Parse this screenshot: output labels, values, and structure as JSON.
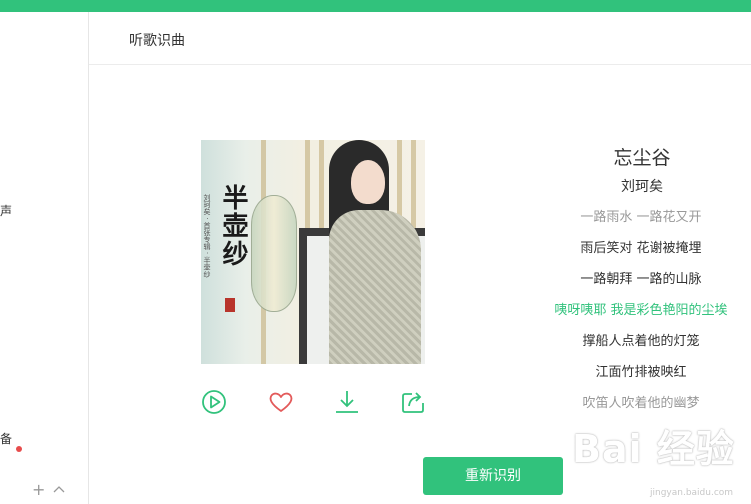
{
  "sidebar": {
    "partial_text_1": "声",
    "partial_text_2": "备",
    "plus_symbol": "+"
  },
  "header": {
    "title": "听歌识曲"
  },
  "cover": {
    "album_title": "半壶纱",
    "subtitle": "刘珂矣 · 首张专辑 · 半壶纱"
  },
  "song": {
    "title": "忘尘谷",
    "artist": "刘珂矣"
  },
  "lyrics": [
    {
      "text": "一路雨水 一路花又开",
      "state": "faded"
    },
    {
      "text": "雨后笑对 花谢被掩埋",
      "state": "normal"
    },
    {
      "text": "一路朝拜 一路的山脉",
      "state": "normal"
    },
    {
      "text": "咦呀咦耶 我是彩色艳阳的尘埃",
      "state": "current"
    },
    {
      "text": "撑船人点着他的灯笼",
      "state": "normal"
    },
    {
      "text": "江面竹排被映红",
      "state": "normal"
    },
    {
      "text": "吹笛人吹着他的幽梦",
      "state": "faded"
    }
  ],
  "actions": {
    "icons": [
      "play-icon",
      "heart-icon",
      "download-icon",
      "share-icon"
    ]
  },
  "retry_button": {
    "label": "重新识别"
  },
  "watermark": {
    "text": "Bai 经验",
    "url": "jingyan.baidu.com"
  },
  "colors": {
    "accent": "#31c27c",
    "text": "#333333",
    "muted": "#999999",
    "dot": "#e74c4c"
  }
}
